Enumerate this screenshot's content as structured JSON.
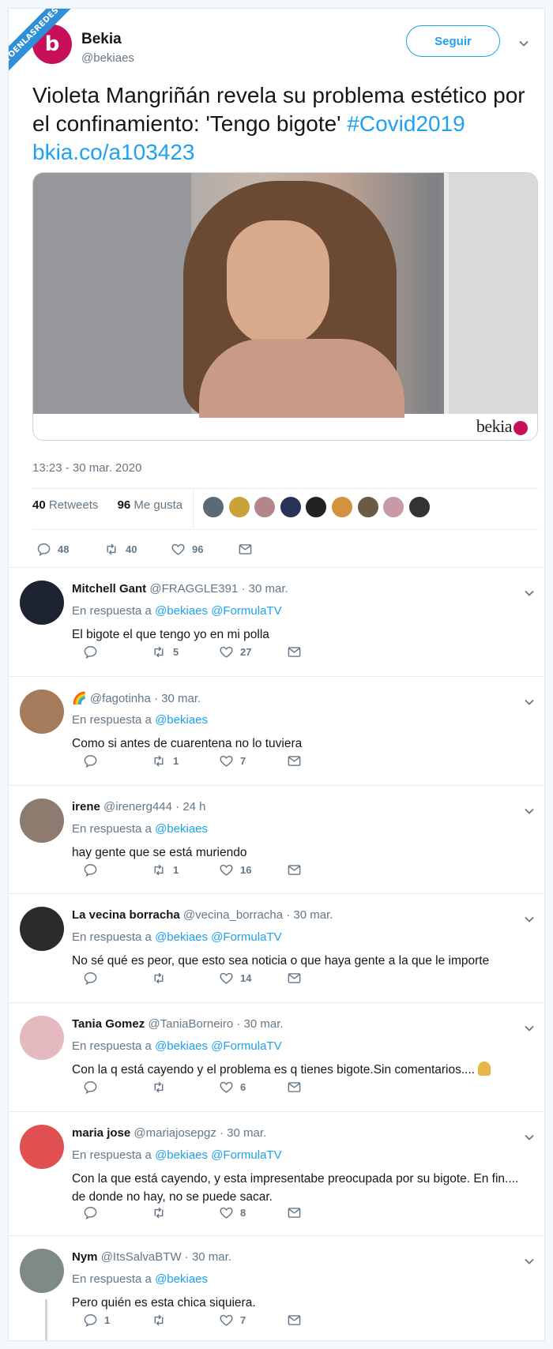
{
  "watermark": "VISTOENLASREDES .com",
  "account": {
    "initial": "b",
    "name": "Bekia",
    "handle": "@bekiaes"
  },
  "follow_label": "Seguir",
  "tweet": {
    "text": "Violeta Mangriñán revela su problema estético por el confinamiento: 'Tengo bigote'",
    "hashtag": "#Covid2019",
    "link": "bkia.co/a103423",
    "media_logo": "bekia"
  },
  "timestamp": "13:23 - 30 mar. 2020",
  "stats": {
    "retweets_count": "40",
    "retweets_label": "Retweets",
    "likes_count": "96",
    "likes_label": "Me gusta"
  },
  "liker_colors": [
    "#5b6a74",
    "#c9a23a",
    "#b3868c",
    "#2a3357",
    "#222222",
    "#d4923e",
    "#6b5a45",
    "#c89aa6",
    "#333333"
  ],
  "main_actions": {
    "replies": "48",
    "retweets": "40",
    "likes": "96"
  },
  "replies": [
    {
      "name": "Mitchell Gant",
      "handle": "@FRAGGLE391",
      "time": "· 30 mar.",
      "prefix": "En respuesta a",
      "to": "@bekiaes @FormulaTV",
      "text": "El bigote el que tengo yo en mi polla",
      "replies": "",
      "retweets": "5",
      "likes": "27",
      "avatar_color": "#1d2330"
    },
    {
      "name": "🌈",
      "handle": "@fagotinha",
      "time": "· 30 mar.",
      "prefix": "En respuesta a",
      "to": "@bekiaes",
      "text": "Como si antes de cuarentena no lo tuviera",
      "replies": "",
      "retweets": "1",
      "likes": "7",
      "avatar_color": "#a47c5c"
    },
    {
      "name": "irene",
      "handle": "@irenerg444",
      "time": "· 24 h",
      "prefix": "En respuesta a",
      "to": "@bekiaes",
      "text": "hay gente que se está muriendo",
      "replies": "",
      "retweets": "1",
      "likes": "16",
      "avatar_color": "#8c7b6e"
    },
    {
      "name": "La vecina borracha",
      "handle": "@vecina_borracha",
      "time": "· 30 mar.",
      "prefix": "En respuesta a",
      "to": "@bekiaes @FormulaTV",
      "text": "No sé qué es peor, que esto sea noticia o que haya gente a la que le importe",
      "replies": "",
      "retweets": "",
      "likes": "14",
      "avatar_color": "#2b2b2b"
    },
    {
      "name": "Tania Gomez",
      "handle": "@TaniaBorneiro",
      "time": "· 30 mar.",
      "prefix": "En respuesta a",
      "to": "@bekiaes @FormulaTV",
      "text": "Con la q está cayendo y el problema es q tienes bigote.Sin comentarios....",
      "replies": "",
      "retweets": "",
      "likes": "6",
      "avatar_color": "#e4b9bf"
    },
    {
      "name": "maria jose",
      "handle": "@mariajosepgz",
      "time": "· 30 mar.",
      "prefix": "En respuesta a",
      "to": "@bekiaes @FormulaTV",
      "text": "Con la que está cayendo, y esta impresentabe preocupada por su bigote. En fin.... de donde no hay, no se puede sacar.",
      "replies": "",
      "retweets": "",
      "likes": "8",
      "avatar_color": "#e05050"
    },
    {
      "name": "Nym",
      "handle": "@ItsSalvaBTW",
      "time": "· 30 mar.",
      "prefix": "En respuesta a",
      "to": "@bekiaes",
      "text": "Pero quién es esta chica siquiera.",
      "replies": "1",
      "retweets": "",
      "likes": "7",
      "avatar_color": "#7d8a86"
    }
  ]
}
